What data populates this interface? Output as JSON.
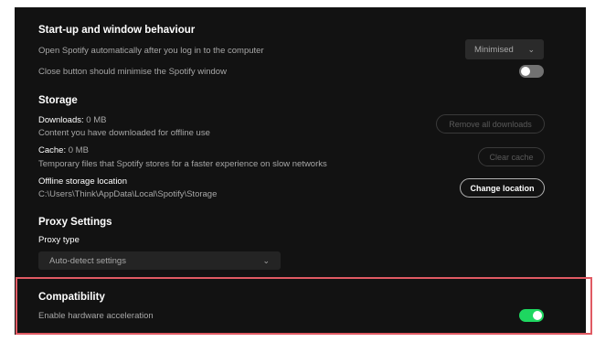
{
  "startup": {
    "title": "Start-up and window behaviour",
    "open_auto_label": "Open Spotify automatically after you log in to the computer",
    "open_auto_value": "Minimised",
    "close_btn_label": "Close button should minimise the Spotify window",
    "close_btn_toggle_on": false
  },
  "storage": {
    "title": "Storage",
    "downloads_label": "Downloads:",
    "downloads_value": "0 MB",
    "downloads_desc": "Content you have downloaded for offline use",
    "remove_downloads_button": "Remove all downloads",
    "cache_label": "Cache:",
    "cache_value": "0 MB",
    "cache_desc": "Temporary files that Spotify stores for a faster experience on slow networks",
    "clear_cache_button": "Clear cache",
    "offline_location_label": "Offline storage location",
    "offline_location_path": "C:\\Users\\Think\\AppData\\Local\\Spotify\\Storage",
    "change_location_button": "Change location"
  },
  "proxy": {
    "title": "Proxy Settings",
    "type_label": "Proxy type",
    "type_value": "Auto-detect settings"
  },
  "compatibility": {
    "title": "Compatibility",
    "hw_accel_label": "Enable hardware acceleration",
    "hw_accel_toggle_on": true
  },
  "colors": {
    "background": "#121212",
    "toggle_on": "#1ed760",
    "toggle_off": "#727272",
    "highlight": "#e05a63"
  }
}
